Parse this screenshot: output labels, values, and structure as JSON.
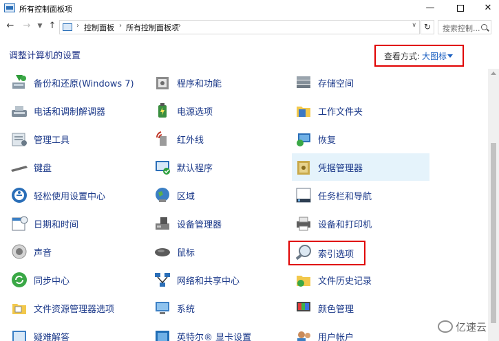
{
  "window": {
    "title": "所有控制面板项",
    "minimize": "—",
    "close": "✕"
  },
  "address": {
    "crumbs": [
      "控制面板",
      "所有控制面板项"
    ],
    "search_placeholder": "搜索控制..."
  },
  "header": {
    "title": "调整计算机的设置",
    "view_by_label": "查看方式:",
    "view_by_value": "大图标"
  },
  "items": [
    {
      "label": "备份和还原(Windows 7)",
      "icon": "backup-restore-icon"
    },
    {
      "label": "程序和功能",
      "icon": "programs-features-icon"
    },
    {
      "label": "存储空间",
      "icon": "storage-spaces-icon"
    },
    {
      "label": "电话和调制解调器",
      "icon": "phone-modem-icon"
    },
    {
      "label": "电源选项",
      "icon": "power-options-icon"
    },
    {
      "label": "工作文件夹",
      "icon": "work-folders-icon"
    },
    {
      "label": "管理工具",
      "icon": "admin-tools-icon"
    },
    {
      "label": "红外线",
      "icon": "infrared-icon"
    },
    {
      "label": "恢复",
      "icon": "recovery-icon"
    },
    {
      "label": "键盘",
      "icon": "keyboard-icon"
    },
    {
      "label": "默认程序",
      "icon": "default-programs-icon"
    },
    {
      "label": "凭据管理器",
      "icon": "credential-manager-icon"
    },
    {
      "label": "轻松使用设置中心",
      "icon": "ease-of-access-icon"
    },
    {
      "label": "区域",
      "icon": "region-icon"
    },
    {
      "label": "任务栏和导航",
      "icon": "taskbar-navigation-icon"
    },
    {
      "label": "日期和时间",
      "icon": "date-time-icon"
    },
    {
      "label": "设备管理器",
      "icon": "device-manager-icon"
    },
    {
      "label": "设备和打印机",
      "icon": "devices-printers-icon"
    },
    {
      "label": "声音",
      "icon": "sound-icon"
    },
    {
      "label": "鼠标",
      "icon": "mouse-icon"
    },
    {
      "label": "索引选项",
      "icon": "indexing-options-icon"
    },
    {
      "label": "同步中心",
      "icon": "sync-center-icon"
    },
    {
      "label": "网络和共享中心",
      "icon": "network-sharing-icon"
    },
    {
      "label": "文件历史记录",
      "icon": "file-history-icon"
    },
    {
      "label": "文件资源管理器选项",
      "icon": "explorer-options-icon"
    },
    {
      "label": "系统",
      "icon": "system-icon"
    },
    {
      "label": "颜色管理",
      "icon": "color-management-icon"
    },
    {
      "label": "疑难解答",
      "icon": "troubleshooting-icon"
    },
    {
      "label": "英特尔® 显卡设置",
      "icon": "intel-graphics-icon"
    },
    {
      "label": "用户帐户",
      "icon": "user-accounts-icon"
    }
  ],
  "watermark": {
    "text": "亿速云"
  }
}
